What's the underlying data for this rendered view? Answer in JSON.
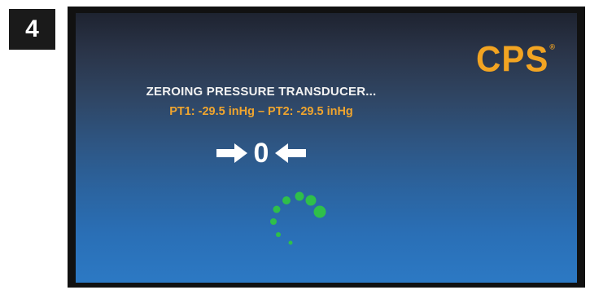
{
  "step": {
    "number": "4"
  },
  "screen": {
    "logo_text": "CPS",
    "logo_mark": "®",
    "title": "ZEROING PRESSURE TRANSDUCER...",
    "readout": "PT1: -29.5 inHg – PT2: -29.5 inHg",
    "zero_value": "0",
    "left_arrow_icon": "arrow-right-icon",
    "right_arrow_icon": "arrow-left-icon",
    "spinner_icon": "loading-spinner-icon"
  },
  "colors": {
    "accent": "#f2a422",
    "spinner": "#2fbf4a",
    "text": "#f2f2f2"
  }
}
